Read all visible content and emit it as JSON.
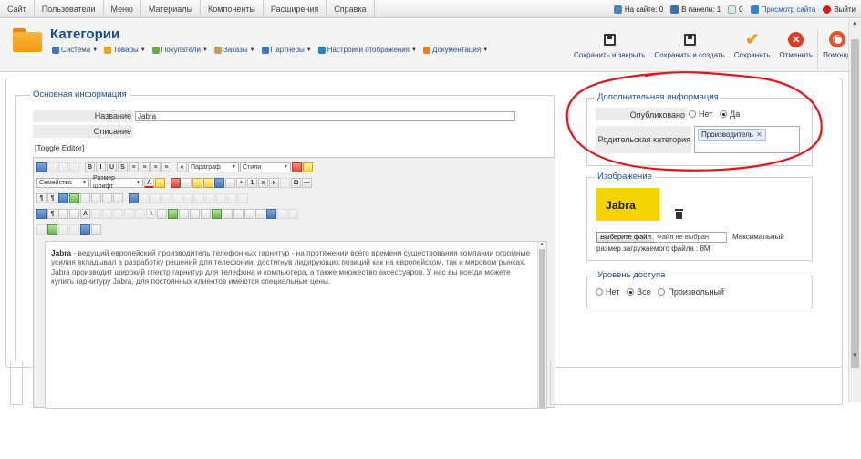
{
  "topmenu": {
    "items": [
      "Сайт",
      "Пользователи",
      "Меню",
      "Материалы",
      "Компоненты",
      "Расширения",
      "Справка"
    ],
    "on_site": "На сайте: 0",
    "in_panel": "В панели: 1",
    "messages": "0",
    "view_site": "Просмотр сайта",
    "logout": "Выйти"
  },
  "header": {
    "title": "Категории",
    "submenu": [
      "Система",
      "Товары",
      "Покупатели",
      "Заказы",
      "Партнеры",
      "Настройки отображения",
      "Документация"
    ],
    "submenu_colors": [
      "#3a79c2",
      "#f2a31a",
      "#6aa84f",
      "#c0a060",
      "#3a79c2",
      "#2c7fc2",
      "#e0802a"
    ]
  },
  "toolbar": {
    "save_close": "Сохранить и закрыть",
    "save_new": "Сохранить и создать",
    "save": "Сохранить",
    "cancel": "Отменить",
    "help": "Помощь"
  },
  "basic": {
    "legend": "Основная информация",
    "name_label": "Название",
    "name_value": "Jabra",
    "desc_label": "Описание",
    "toggle_editor": "[Toggle Editor]"
  },
  "editor": {
    "format_value": "Параграф",
    "styles_value": "Стили",
    "font_family": "Семейство",
    "font_size": "Размер шрифт",
    "content_bold": "Jabra",
    "content_rest": " - ведущий европейский производитель телефонных гарнитур - на протяжении всего времени существования компании огромные усилия вкладывал в разработку решений для телефонии, достигнув лидирующих позиций как на европейском, так и мировом рынках. Jabra производит широкий спектр гарнитур для телефона и компьютера, а также множество аксессуаров. У нас вы всегда можете купить гарнитуру Jabra, для постоянных клиентов имеются специальные цены."
  },
  "extra": {
    "legend": "Дополнительная информация",
    "published_label": "Опубликовано",
    "no": "Нет",
    "yes": "Да",
    "parent_label": "Родительская категория",
    "parent_tag": "Производитель"
  },
  "image": {
    "legend": "Изображение",
    "logo_text": "Jabra",
    "choose_file": "Выберите файл",
    "no_file": "Файл не выбран",
    "max_size_1": "Максимальный",
    "max_size_2": "размер загружаемого файла : 8M"
  },
  "access": {
    "legend": "Уровень доступа",
    "options": [
      "Нет",
      "Все",
      "Произвольный"
    ],
    "selected": "Все"
  },
  "colors": {
    "accent_blue": "#1f4e8c",
    "annotation_red": "#e8141c",
    "jabra_yellow": "#f4d400"
  }
}
